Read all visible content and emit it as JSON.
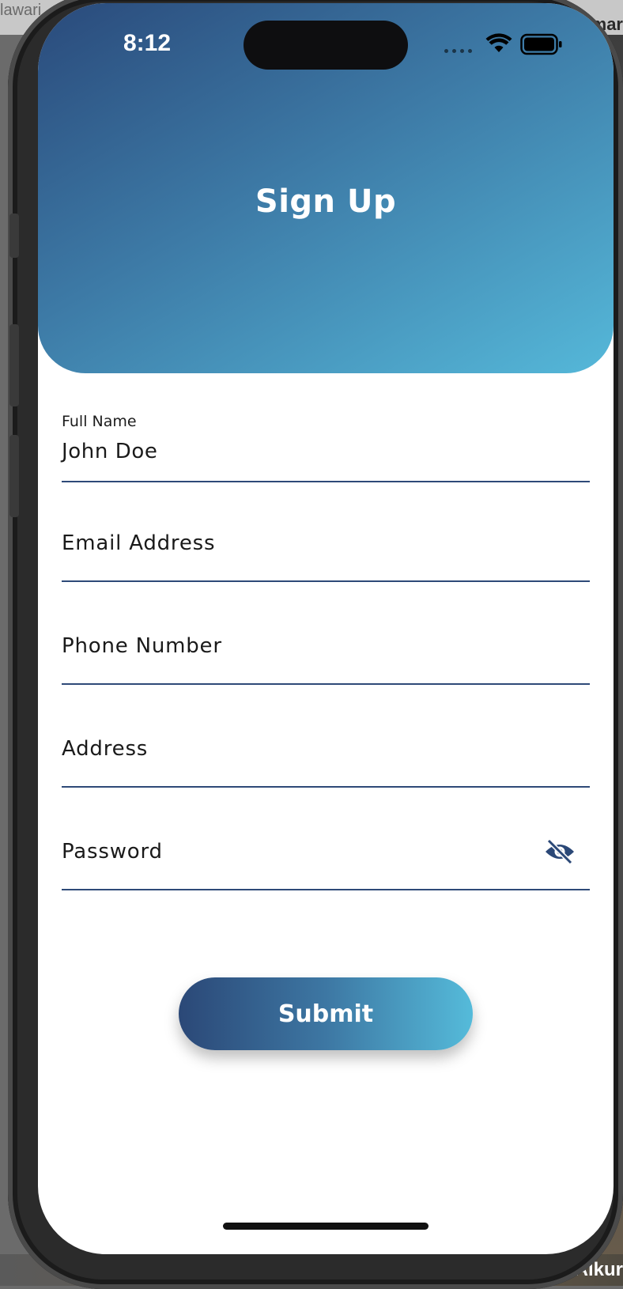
{
  "desktop": {
    "top_left_text": "lawari",
    "top_right_text": "Emar",
    "bottom_right_text": "Alkur"
  },
  "status_bar": {
    "time": "8:12"
  },
  "header": {
    "title": "Sign Up"
  },
  "form": {
    "full_name": {
      "label": "Full Name",
      "value": "John Doe"
    },
    "email": {
      "placeholder": "Email Address"
    },
    "phone": {
      "placeholder": "Phone Number"
    },
    "address": {
      "placeholder": "Address"
    },
    "password": {
      "placeholder": "Password",
      "toggle_icon": "eye-slash-icon"
    }
  },
  "submit_label": "Submit",
  "colors": {
    "gradient_start": "#2a4a7b",
    "gradient_end": "#55b8d9",
    "underline": "#2e4a78",
    "icon": "#2b4877"
  }
}
